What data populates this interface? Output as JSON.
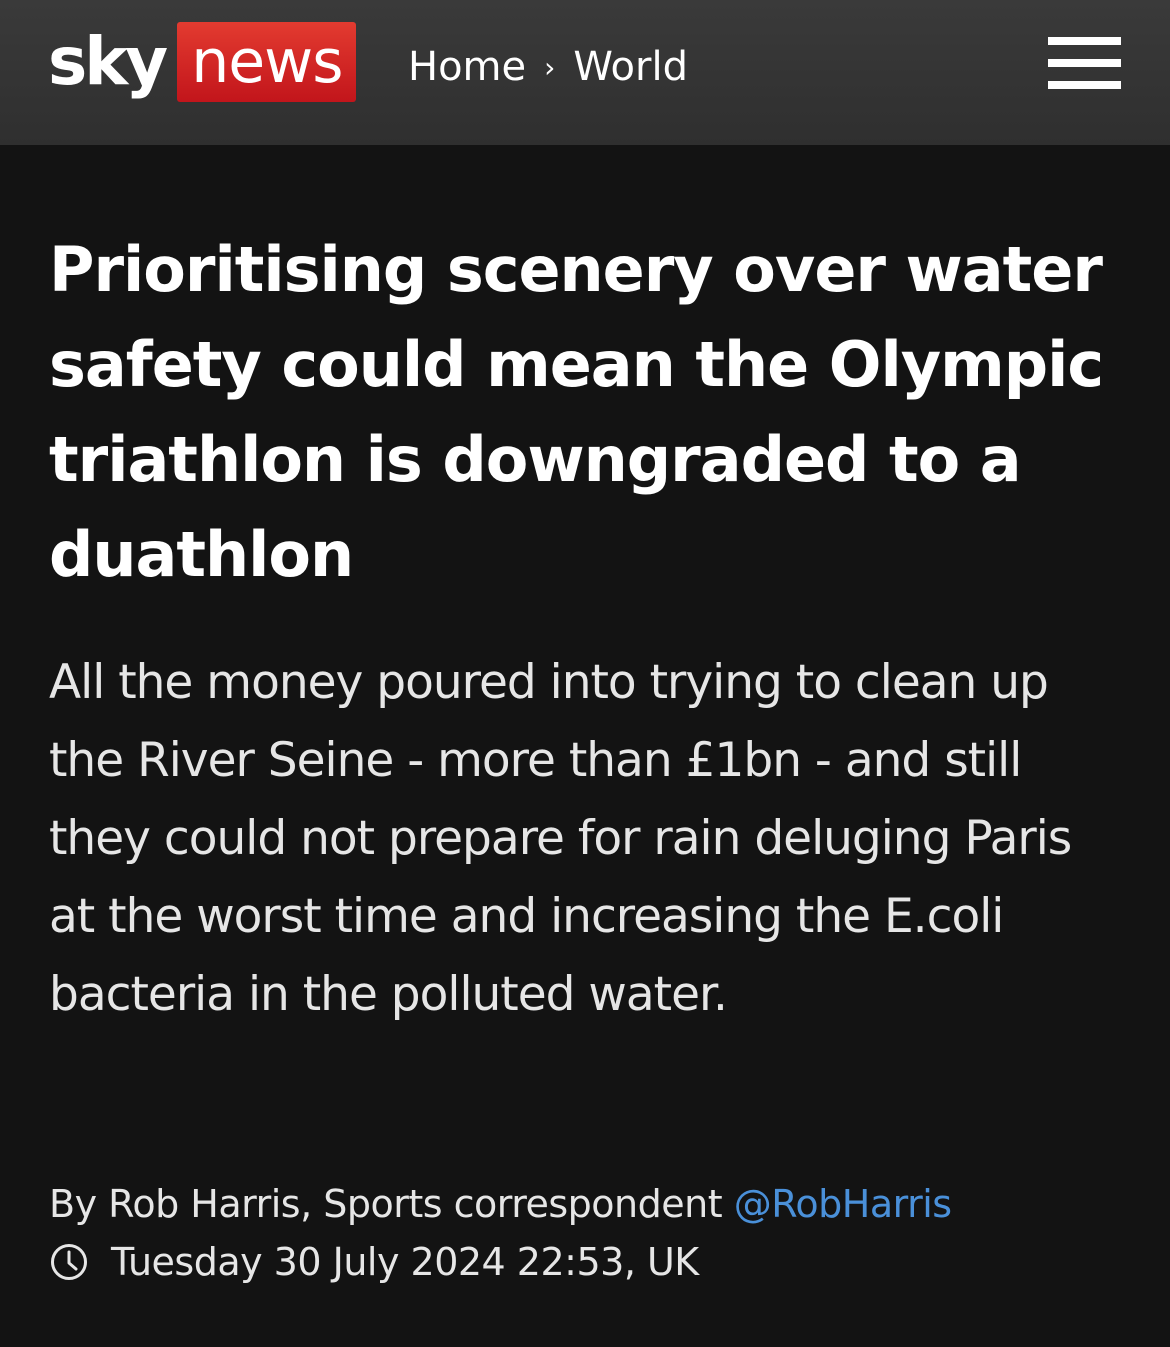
{
  "header": {
    "logo_sky": "sky",
    "logo_news": "news",
    "breadcrumb": {
      "home": "Home",
      "separator": "›",
      "section": "World"
    },
    "menu_icon": "hamburger-menu-icon"
  },
  "article": {
    "headline": "Prioritising scenery over water safety could mean the Olympic triathlon is downgraded to a duathlon",
    "standfirst": "All the money poured into trying to clean up the River Seine - more than £1bn - and still they could not prepare for rain deluging Paris at the worst time and increasing the E.coli bacteria in the polluted water.",
    "byline_prefix": "By Rob Harris, Sports correspondent",
    "twitter_handle": "@RobHarris",
    "timestamp": "Tuesday 30 July 2024 22:53, UK",
    "clock_icon": "clock-icon"
  },
  "colors": {
    "background": "#131313",
    "header_background": "#333333",
    "brand_red": "#d0242b",
    "link_blue": "#4a90d9",
    "text_primary": "#ffffff",
    "text_secondary": "#e6e6e6"
  }
}
